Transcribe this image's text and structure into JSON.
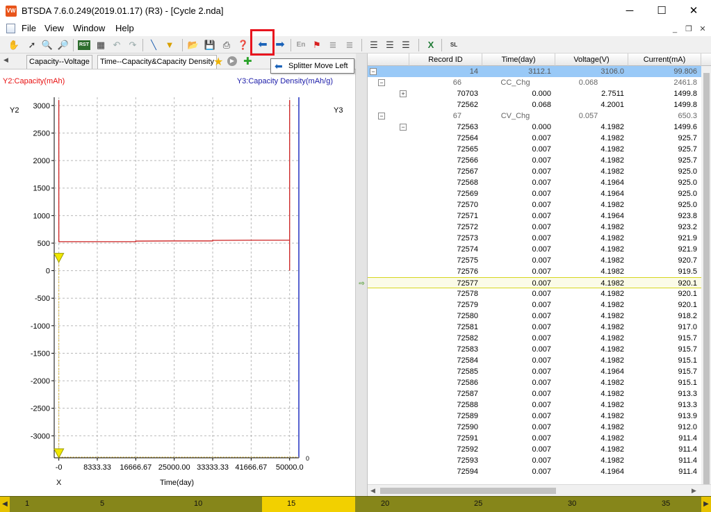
{
  "window": {
    "title": "BTSDA 7.6.0.249(2019.01.17) (R3) - [Cycle 2.nda]",
    "logo_text": "VW",
    "minimize": "─",
    "maximize": "☐",
    "close": "✕"
  },
  "menu": {
    "items": [
      "File",
      "View",
      "Window",
      "Help"
    ],
    "mdi_minimize": "_",
    "mdi_restore": "❐",
    "mdi_close": "✕"
  },
  "toolbar": {
    "icons": [
      "hand",
      "pointer",
      "zoom-in",
      "zoom-area",
      "rst",
      "copy-chart",
      "undo",
      "redo",
      "line-tool",
      "filter",
      "open-folder",
      "save",
      "print",
      "help",
      "splitter-move-left",
      "splitter-move-right",
      "en",
      "marker",
      "cascade-1",
      "cascade-2",
      "grid-1",
      "grid-2",
      "grid-3",
      "excel",
      "export"
    ],
    "en_label": "En",
    "rst_label": "RST",
    "export_label": "SL",
    "tooltip": "Splitter Move Left"
  },
  "tabs": [
    {
      "label": "Capacity--Voltage",
      "active": false
    },
    {
      "label": "Time--Capacity&Capacity Density",
      "active": true
    }
  ],
  "chart": {
    "y2_title": "Y2:Capacity(mAh)",
    "y3_title": "Y3:Capacity Density(mAh/g)",
    "y2_name": "Y2",
    "y3_name": "Y3",
    "x_name": "X",
    "x_title": "Time(day)",
    "y3_tick": "0",
    "colors": {
      "series": "#cc2020",
      "y3_axis": "#2030c0",
      "grid": "#b8b8b8",
      "marker": "#f0e800"
    }
  },
  "chart_data": {
    "type": "line",
    "title": "",
    "xlabel": "Time(day)",
    "ylabel": "Y2:Capacity(mAh)",
    "y2label": "Y3:Capacity Density(mAh/g)",
    "xlim": [
      -1000,
      52000
    ],
    "ylim": [
      -3400,
      3150
    ],
    "x_ticks": [
      "-0",
      "8333.33",
      "16666.67",
      "25000.00",
      "33333.33",
      "41666.67",
      "50000.0"
    ],
    "x_tick_values": [
      0,
      8333.33,
      16666.67,
      25000,
      33333.33,
      41666.67,
      50000
    ],
    "y_ticks": [
      3000,
      2500,
      2000,
      1500,
      1000,
      500,
      0,
      -500,
      -1000,
      -1500,
      -2000,
      -2500,
      -3000
    ],
    "y3_ticks": [
      0
    ],
    "grid": true,
    "series": [
      {
        "x": [
          0,
          0,
          8333.33,
          16666.67,
          16666.67,
          25000,
          33333.33,
          33333.33,
          41666.67,
          50000,
          50000,
          50000
        ],
        "values": [
          3100,
          527,
          527,
          527,
          537,
          540,
          540,
          550,
          553,
          553,
          3100,
          0
        ]
      }
    ]
  },
  "grid": {
    "columns": [
      "Record ID",
      "Time(day)",
      "Voltage(V)",
      "Current(mA)"
    ],
    "summary": {
      "id": "14",
      "time": "3112.1",
      "voltage": "3106.0",
      "current": "99.806"
    },
    "groups": [
      {
        "step": "66",
        "type": "CC_Chg",
        "time": "0.068",
        "current": "2461.8",
        "records": [
          {
            "id": "70703",
            "time": "0.000",
            "voltage": "2.7511",
            "current": "1499.8"
          },
          {
            "id": "72562",
            "time": "0.068",
            "voltage": "4.2001",
            "current": "1499.8"
          }
        ]
      },
      {
        "step": "67",
        "type": "CV_Chg",
        "time": "0.057",
        "current": "650.3",
        "records": [
          {
            "id": "72563",
            "time": "0.000",
            "voltage": "4.1982",
            "current": "1499.6"
          },
          {
            "id": "72564",
            "time": "0.007",
            "voltage": "4.1982",
            "current": "925.7"
          },
          {
            "id": "72565",
            "time": "0.007",
            "voltage": "4.1982",
            "current": "925.7"
          },
          {
            "id": "72566",
            "time": "0.007",
            "voltage": "4.1982",
            "current": "925.7"
          },
          {
            "id": "72567",
            "time": "0.007",
            "voltage": "4.1982",
            "current": "925.0"
          },
          {
            "id": "72568",
            "time": "0.007",
            "voltage": "4.1964",
            "current": "925.0"
          },
          {
            "id": "72569",
            "time": "0.007",
            "voltage": "4.1964",
            "current": "925.0"
          },
          {
            "id": "72570",
            "time": "0.007",
            "voltage": "4.1982",
            "current": "925.0"
          },
          {
            "id": "72571",
            "time": "0.007",
            "voltage": "4.1964",
            "current": "923.8"
          },
          {
            "id": "72572",
            "time": "0.007",
            "voltage": "4.1982",
            "current": "923.2"
          },
          {
            "id": "72573",
            "time": "0.007",
            "voltage": "4.1982",
            "current": "921.9"
          },
          {
            "id": "72574",
            "time": "0.007",
            "voltage": "4.1982",
            "current": "921.9"
          },
          {
            "id": "72575",
            "time": "0.007",
            "voltage": "4.1982",
            "current": "920.7"
          },
          {
            "id": "72576",
            "time": "0.007",
            "voltage": "4.1982",
            "current": "919.5"
          },
          {
            "id": "72577",
            "time": "0.007",
            "voltage": "4.1982",
            "current": "920.1"
          },
          {
            "id": "72578",
            "time": "0.007",
            "voltage": "4.1982",
            "current": "920.1"
          },
          {
            "id": "72579",
            "time": "0.007",
            "voltage": "4.1982",
            "current": "920.1"
          },
          {
            "id": "72580",
            "time": "0.007",
            "voltage": "4.1982",
            "current": "918.2"
          },
          {
            "id": "72581",
            "time": "0.007",
            "voltage": "4.1982",
            "current": "917.0"
          },
          {
            "id": "72582",
            "time": "0.007",
            "voltage": "4.1982",
            "current": "915.7"
          },
          {
            "id": "72583",
            "time": "0.007",
            "voltage": "4.1982",
            "current": "915.7"
          },
          {
            "id": "72584",
            "time": "0.007",
            "voltage": "4.1982",
            "current": "915.1"
          },
          {
            "id": "72585",
            "time": "0.007",
            "voltage": "4.1964",
            "current": "915.7"
          },
          {
            "id": "72586",
            "time": "0.007",
            "voltage": "4.1982",
            "current": "915.1"
          },
          {
            "id": "72587",
            "time": "0.007",
            "voltage": "4.1982",
            "current": "913.3"
          },
          {
            "id": "72588",
            "time": "0.007",
            "voltage": "4.1982",
            "current": "913.3"
          },
          {
            "id": "72589",
            "time": "0.007",
            "voltage": "4.1982",
            "current": "913.9"
          },
          {
            "id": "72590",
            "time": "0.007",
            "voltage": "4.1982",
            "current": "912.0"
          },
          {
            "id": "72591",
            "time": "0.007",
            "voltage": "4.1982",
            "current": "911.4"
          },
          {
            "id": "72592",
            "time": "0.007",
            "voltage": "4.1982",
            "current": "911.4"
          },
          {
            "id": "72593",
            "time": "0.007",
            "voltage": "4.1982",
            "current": "911.4"
          },
          {
            "id": "72594",
            "time": "0.007",
            "voltage": "4.1964",
            "current": "911.4"
          }
        ]
      }
    ],
    "current_record": "72577",
    "expander_plus": "+",
    "expander_minus": "−"
  },
  "cycle_bar": {
    "labels": [
      "1",
      "5",
      "10",
      "15",
      "20",
      "25",
      "30",
      "35"
    ],
    "selected": "15",
    "left_arrow": "◀",
    "right_arrow": "▶"
  }
}
